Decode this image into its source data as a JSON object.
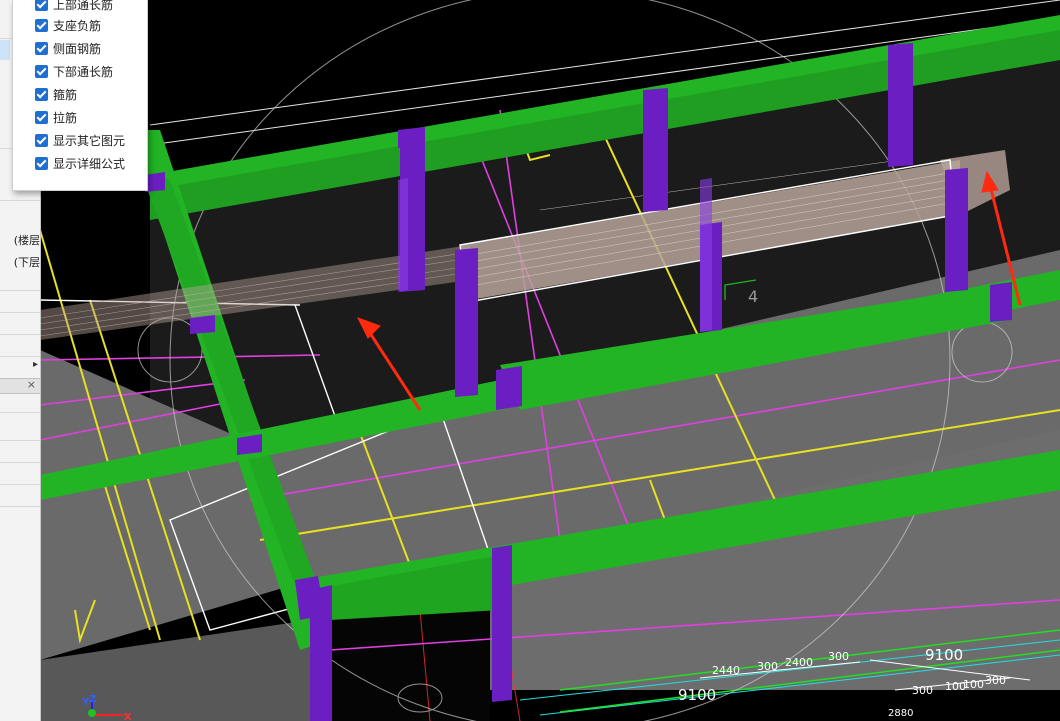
{
  "left_panel": {
    "items": [
      {
        "label": "楼层"
      },
      {
        "label": "楼层)"
      },
      {
        "label": "下层)"
      }
    ],
    "close_glyph": "×",
    "expand_glyph": "▸"
  },
  "display_options": {
    "items": [
      {
        "label": "上部通长筋",
        "checked": true
      },
      {
        "label": "支座负筋",
        "checked": true
      },
      {
        "label": "侧面钢筋",
        "checked": true
      },
      {
        "label": "下部通长筋",
        "checked": true
      },
      {
        "label": "箍筋",
        "checked": true
      },
      {
        "label": "拉筋",
        "checked": true
      },
      {
        "label": "显示其它图元",
        "checked": true
      },
      {
        "label": "显示详细公式",
        "checked": true
      }
    ]
  },
  "viewport": {
    "axis_tag": "4",
    "dimensions": {
      "d1": "9100",
      "d2": "9100",
      "d3": "2440",
      "d4": "300",
      "d5": "2400",
      "d6": "300",
      "d7": "300",
      "d8": "100",
      "d9": "100",
      "d10": "300",
      "d11": "2880"
    },
    "axes": {
      "x": "X",
      "y": "Y",
      "z": "Z"
    },
    "colors": {
      "beam": "#22b424",
      "column": "#6b1fc2",
      "slab": "#6a6a6a",
      "rebar_highlight": "#b7a39a",
      "magenta_line": "#e040e0",
      "yellow_line": "#e8e020",
      "arrow": "#ff2a10"
    }
  }
}
